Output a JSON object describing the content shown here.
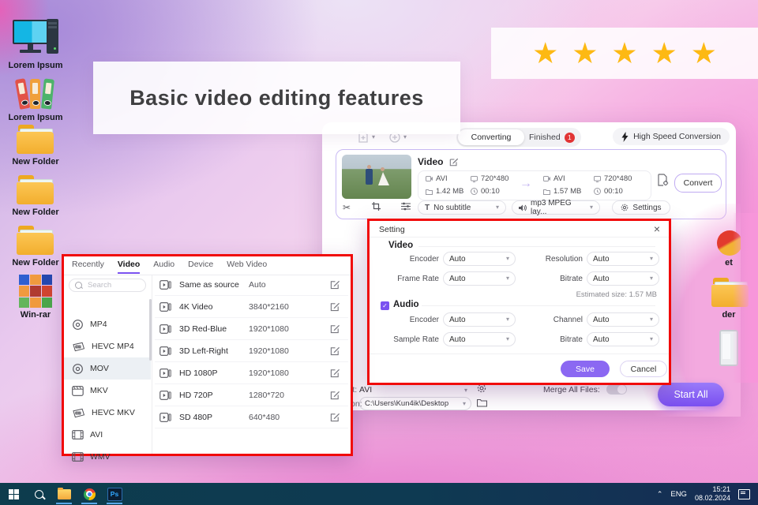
{
  "banner": {
    "title": "Basic video editing features"
  },
  "rating": {
    "stars": 5,
    "star_glyph": "★",
    "color": "#fdb913"
  },
  "desktop": {
    "icons": [
      {
        "label": "Lorem Ipsum",
        "type": "computer"
      },
      {
        "label": "Lorem Ipsum",
        "type": "binders"
      },
      {
        "label": "New Folder",
        "type": "folder"
      },
      {
        "label": "New Folder",
        "type": "folder"
      },
      {
        "label": "New Folder",
        "type": "folder"
      },
      {
        "label": "Win-rar",
        "type": "winrar"
      }
    ],
    "right_icons": [
      {
        "label": "et",
        "type": "internet"
      },
      {
        "label": "der",
        "type": "folder"
      },
      {
        "label": "",
        "type": "bin"
      }
    ]
  },
  "app": {
    "tabs": {
      "converting": "Converting",
      "finished": "Finished",
      "finished_badge": "1"
    },
    "high_speed": "High Speed Conversion",
    "item": {
      "title": "Video",
      "source": {
        "format": "AVI",
        "size": "1.42 MB",
        "resolution": "720*480",
        "duration": "00:10"
      },
      "target": {
        "format": "AVI",
        "size": "1.57 MB",
        "resolution": "720*480",
        "duration": "00:10"
      },
      "convert_label": "Convert",
      "subtitle_dropdown": "No subtitle",
      "audio_dropdown": "mp3 MPEG lay...",
      "settings_label": "Settings"
    },
    "bottom": {
      "format_label": "Format:",
      "format_value": "AVI",
      "merge_label": "Merge All Files:",
      "location_label": "Location:",
      "location_value": "C:\\Users\\Kun4ik\\Desktop",
      "start_all": "Start All"
    }
  },
  "format_panel": {
    "tabs": [
      {
        "label": "Recently",
        "active": false
      },
      {
        "label": "Video",
        "active": true
      },
      {
        "label": "Audio",
        "active": false
      },
      {
        "label": "Device",
        "active": false
      },
      {
        "label": "Web Video",
        "active": false
      }
    ],
    "search_placeholder": "Search",
    "formats": [
      {
        "label": "MP4",
        "icon": "disc",
        "selected": false
      },
      {
        "label": "HEVC MP4",
        "icon": "hevc",
        "selected": false
      },
      {
        "label": "MOV",
        "icon": "disc",
        "selected": true
      },
      {
        "label": "MKV",
        "icon": "clapper",
        "selected": false
      },
      {
        "label": "HEVC MKV",
        "icon": "hevc",
        "selected": false
      },
      {
        "label": "AVI",
        "icon": "film",
        "selected": false
      },
      {
        "label": "WMV",
        "icon": "film",
        "selected": false
      }
    ],
    "presets": [
      {
        "name": "Same as source",
        "resolution": "Auto"
      },
      {
        "name": "4K Video",
        "resolution": "3840*2160"
      },
      {
        "name": "3D Red-Blue",
        "resolution": "1920*1080"
      },
      {
        "name": "3D Left-Right",
        "resolution": "1920*1080"
      },
      {
        "name": "HD 1080P",
        "resolution": "1920*1080"
      },
      {
        "name": "HD 720P",
        "resolution": "1280*720"
      },
      {
        "name": "SD 480P",
        "resolution": "640*480"
      }
    ]
  },
  "settings_dialog": {
    "title": "Setting",
    "close_glyph": "×",
    "video_section": "Video",
    "audio_section": "Audio",
    "fields": {
      "video": [
        {
          "label": "Encoder",
          "value": "Auto"
        },
        {
          "label": "Resolution",
          "value": "Auto"
        },
        {
          "label": "Frame Rate",
          "value": "Auto"
        },
        {
          "label": "Bitrate",
          "value": "Auto"
        }
      ],
      "audio": [
        {
          "label": "Encoder",
          "value": "Auto"
        },
        {
          "label": "Channel",
          "value": "Auto"
        },
        {
          "label": "Sample Rate",
          "value": "Auto"
        },
        {
          "label": "Bitrate",
          "value": "Auto"
        }
      ]
    },
    "estimated_size": "Estimated size: 1.57 MB",
    "save": "Save",
    "cancel": "Cancel"
  },
  "taskbar": {
    "lang": "ENG",
    "time": "15:21",
    "date": "08.02.2024"
  },
  "colors": {
    "accent": "#7b52f0",
    "annotation": "#f10a0a",
    "star": "#fdb913",
    "taskbar": "#0d3c4d"
  }
}
